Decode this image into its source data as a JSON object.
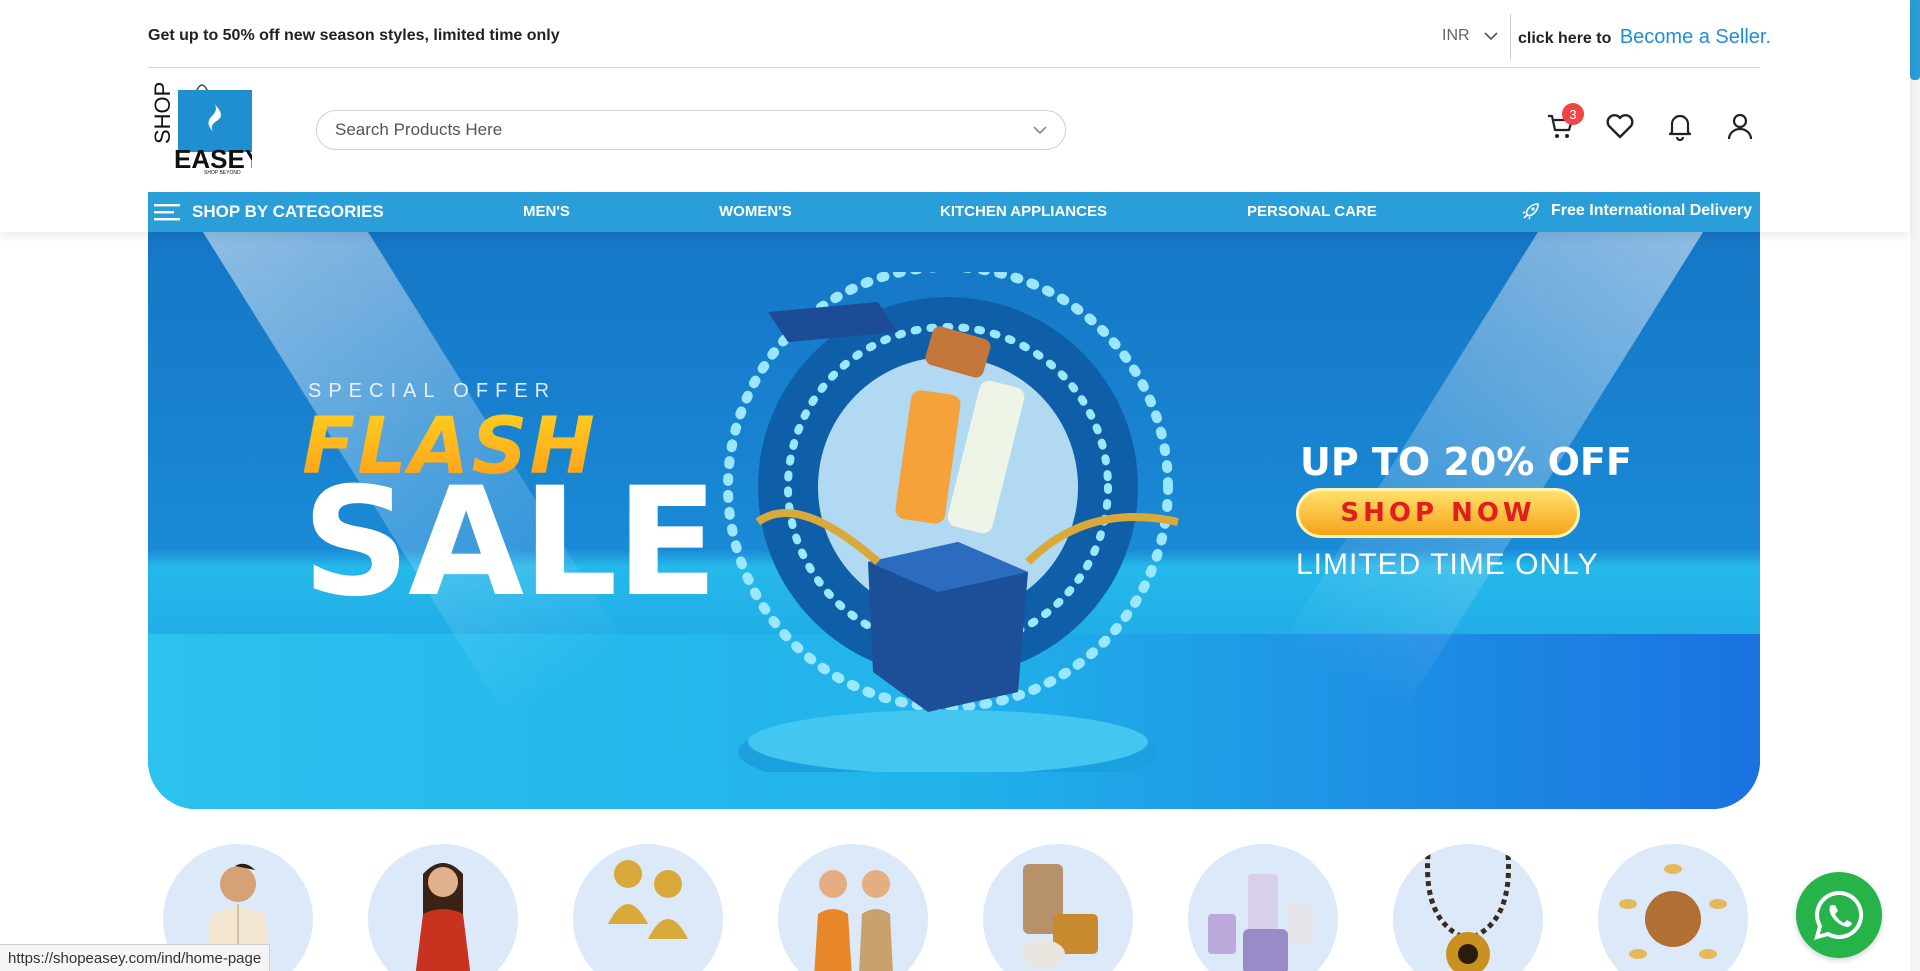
{
  "topbar": {
    "promo_text": "Get up to 50% off new season styles, limited time only",
    "currency": "INR",
    "seller_prefix": "click here to",
    "seller_link": "Become a Seller."
  },
  "logo": {
    "text_shop": "SHOP",
    "text_easey": "EASEY",
    "tagline": "SHOP BEYOND"
  },
  "search": {
    "placeholder": "Search Products Here"
  },
  "header_icons": {
    "cart_count": "3",
    "cart": "cart-icon",
    "wishlist": "heart-icon",
    "notifications": "bell-icon",
    "account": "user-icon"
  },
  "nav": {
    "categories_label": "SHOP BY CATEGORIES",
    "links": [
      "MEN'S",
      "WOMEN'S",
      "KITCHEN APPLIANCES",
      "PERSONAL CARE"
    ],
    "delivery_label": "Free International Delivery"
  },
  "banner": {
    "special": "SPECIAL OFFER",
    "flash": "FLASH",
    "sale": "SALE",
    "discount": "UP TO 20% OFF",
    "cta": "SHOP NOW",
    "limited": "LIMITED TIME ONLY"
  },
  "categories": [
    "men-ethnic",
    "women-dress",
    "earrings",
    "kids",
    "soap",
    "mixer-grinder",
    "necklace",
    "dry-fruits"
  ],
  "status_url": "https://shopeasey.com/ind/home-page",
  "colors": {
    "brand_blue": "#2a9ed8",
    "badge_red": "#f04545",
    "whatsapp_green": "#25b34a",
    "cta_red": "#e11e1e"
  }
}
